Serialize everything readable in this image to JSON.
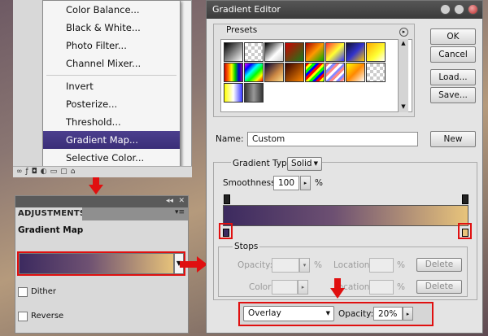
{
  "menu": {
    "items": [
      "Color Balance...",
      "Black & White...",
      "Photo Filter...",
      "Channel Mixer...",
      "Invert",
      "Posterize...",
      "Threshold...",
      "Gradient Map...",
      "Selective Color..."
    ],
    "selected": "Gradient Map..."
  },
  "adjustments": {
    "tab": "ADJUSTMENTS",
    "title": "Gradient Map",
    "dither_label": "Dither",
    "reverse_label": "Reverse",
    "dither_checked": false,
    "reverse_checked": false
  },
  "dialog": {
    "title": "Gradient Editor",
    "presets_label": "Presets",
    "buttons": {
      "ok": "OK",
      "cancel": "Cancel",
      "load": "Load...",
      "save": "Save...",
      "new": "New"
    },
    "name_label": "Name:",
    "name_value": "Custom",
    "gradient_type_label": "Gradient Type:",
    "gradient_type_value": "Solid",
    "smoothness_label": "Smoothness:",
    "smoothness_value": "100",
    "smoothness_unit": "%",
    "stops_label": "Stops",
    "opacity_label": "Opacity:",
    "opacity_unit": "%",
    "color_label": "Color:",
    "location_label": "Location:",
    "location_unit": "%",
    "delete_label": "Delete",
    "blend_mode": "Overlay",
    "blend_opacity_label": "Opacity:",
    "blend_opacity_value": "20%"
  },
  "colors": {
    "accent_red": "#e01010",
    "gradient_start": "#3c2a5f",
    "gradient_end": "#e8c47b",
    "menu_highlight": "#433787"
  }
}
